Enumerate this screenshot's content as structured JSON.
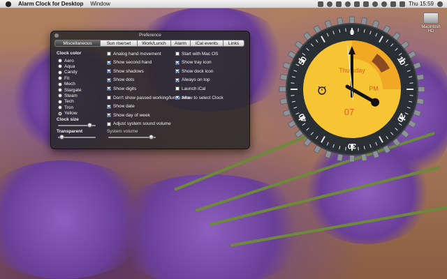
{
  "menubar": {
    "app_name": "Alarm Clock for Desktop",
    "menu_window": "Window",
    "time": "Thu 15:59"
  },
  "desktop": {
    "disk_label": "Macintosh HD"
  },
  "preference": {
    "title": "Preference",
    "tabs": [
      "Miscellaneous",
      "Sun rise/set",
      "Work/Lunch",
      "Alarm",
      "iCal events",
      "Links"
    ],
    "active_tab": "Miscellaneous",
    "clock_color_label": "Clock color",
    "colors": [
      {
        "label": "Aero",
        "selected": false
      },
      {
        "label": "Aqua",
        "selected": false
      },
      {
        "label": "Candy",
        "selected": false
      },
      {
        "label": "Fit",
        "selected": false
      },
      {
        "label": "Mech",
        "selected": false
      },
      {
        "label": "Stargate",
        "selected": false
      },
      {
        "label": "Steam",
        "selected": false
      },
      {
        "label": "Tech",
        "selected": false
      },
      {
        "label": "Tron",
        "selected": false
      },
      {
        "label": "Yellow",
        "selected": true
      }
    ],
    "clock_size_label": "Clock size",
    "clock_size_value": 0.9,
    "transparent_label": "Transparent",
    "transparent_value": 0.05,
    "system_volume_label": "System volume",
    "system_volume_value": 0.95,
    "checks_col1": [
      {
        "label": "Analog hand movement",
        "checked": false
      },
      {
        "label": "Show second hand",
        "checked": true
      },
      {
        "label": "Show shadows",
        "checked": true
      },
      {
        "label": "Show dots",
        "checked": true
      },
      {
        "label": "Show digits",
        "checked": true
      },
      {
        "label": "Don't show passed working/lunch time",
        "checked": false
      },
      {
        "label": "Show date",
        "checked": true
      },
      {
        "label": "Show day of week",
        "checked": true
      },
      {
        "label": "Adjust system sound volume",
        "checked": false
      }
    ],
    "checks_col2": [
      {
        "label": "Start with Mac OS",
        "checked": false
      },
      {
        "label": "Show tray icon",
        "checked": true
      },
      {
        "label": "Show dock icon",
        "checked": true
      },
      {
        "label": "Always on top",
        "checked": true
      },
      {
        "label": "Launch iCal",
        "checked": false
      },
      {
        "label": "Allow to select Clock",
        "checked": true
      }
    ]
  },
  "clock": {
    "day": "Thursday",
    "ampm": "PM",
    "date": "07",
    "bezel_numbers": [
      "50",
      "0",
      "10",
      "20",
      "30",
      "40"
    ],
    "hour": 3,
    "minute": 59,
    "second": 59,
    "colors": {
      "face": "#f7c533",
      "face_inner": "#f1a825",
      "bezel": "#2a2f33",
      "text": "#e05a23"
    }
  }
}
